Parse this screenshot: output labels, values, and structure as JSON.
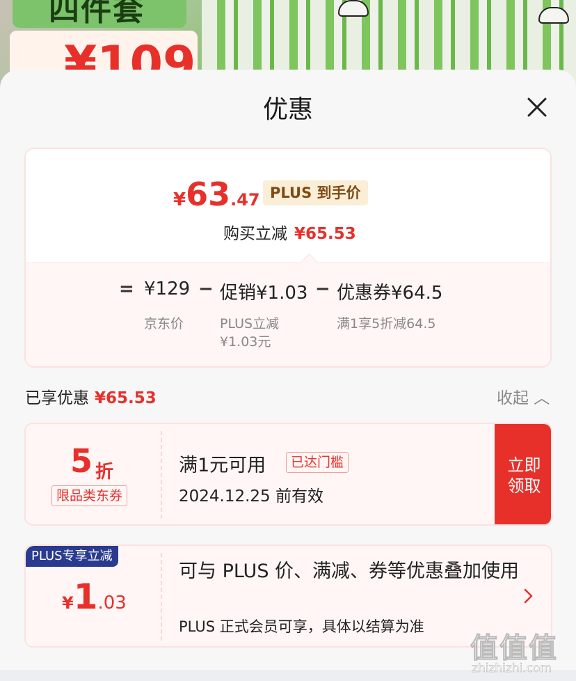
{
  "banner": {
    "set_text": "四件套",
    "price_text": "¥109"
  },
  "sheet": {
    "title": "优惠"
  },
  "summary": {
    "yen": "¥",
    "price_int": "63",
    "price_dec": ".47",
    "plus_tag": "PLUS 到手价",
    "reduce_label": "购买立减",
    "reduce_amount": "¥65.53",
    "formula": {
      "eq": "=",
      "jd_price": "¥129",
      "minus1": "−",
      "promo": "促销¥1.03",
      "minus2": "−",
      "coupon": "优惠券¥64.5",
      "jd_price_label": "京东价",
      "promo_label_line1": "PLUS立减",
      "promo_label_line2": "¥1.03元",
      "coupon_label": "满1享5折减64.5"
    }
  },
  "enjoyed": {
    "label": "已享优惠",
    "amount": "¥65.53",
    "collapse_label": "收起 ︿"
  },
  "coupon": {
    "discount_num": "5",
    "discount_unit": "折",
    "category_tag": "限品类东券",
    "condition": "满1元可用",
    "reached_tag": "已达门槛",
    "valid_until": "2024.12.25 前有效",
    "claim_label": "立即领取"
  },
  "plus_card": {
    "label": "PLUS专享立减",
    "yen": "¥",
    "amount_int": "1",
    "amount_dec": ".03",
    "description": "可与 PLUS 价、满减、券等优惠叠加使用",
    "note": "PLUS 正式会员可享，具体以结算为准"
  },
  "watermark": {
    "chars": "值值值",
    "url": "zhizhizhi.com"
  },
  "colors": {
    "accent_red": "#e8302b",
    "plus_navy": "#2a3b8f",
    "plus_gold_bg": "#fbeed6"
  }
}
